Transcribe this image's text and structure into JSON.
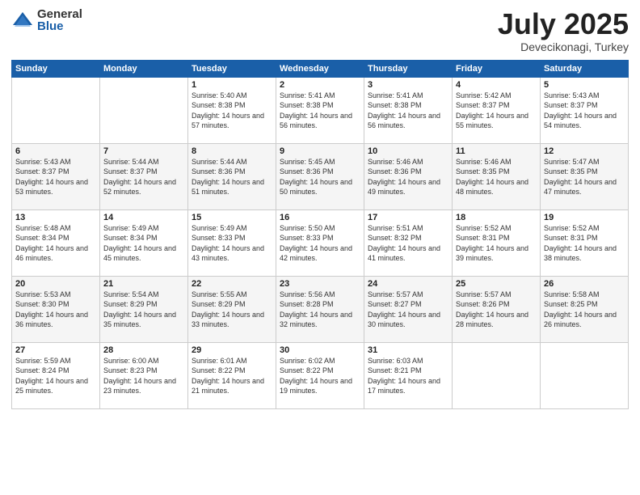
{
  "logo": {
    "general": "General",
    "blue": "Blue"
  },
  "header": {
    "month": "July 2025",
    "location": "Devecikonagi, Turkey"
  },
  "weekdays": [
    "Sunday",
    "Monday",
    "Tuesday",
    "Wednesday",
    "Thursday",
    "Friday",
    "Saturday"
  ],
  "weeks": [
    [
      {
        "day": "",
        "sunrise": "",
        "sunset": "",
        "daylight": ""
      },
      {
        "day": "",
        "sunrise": "",
        "sunset": "",
        "daylight": ""
      },
      {
        "day": "1",
        "sunrise": "Sunrise: 5:40 AM",
        "sunset": "Sunset: 8:38 PM",
        "daylight": "Daylight: 14 hours and 57 minutes."
      },
      {
        "day": "2",
        "sunrise": "Sunrise: 5:41 AM",
        "sunset": "Sunset: 8:38 PM",
        "daylight": "Daylight: 14 hours and 56 minutes."
      },
      {
        "day": "3",
        "sunrise": "Sunrise: 5:41 AM",
        "sunset": "Sunset: 8:38 PM",
        "daylight": "Daylight: 14 hours and 56 minutes."
      },
      {
        "day": "4",
        "sunrise": "Sunrise: 5:42 AM",
        "sunset": "Sunset: 8:37 PM",
        "daylight": "Daylight: 14 hours and 55 minutes."
      },
      {
        "day": "5",
        "sunrise": "Sunrise: 5:43 AM",
        "sunset": "Sunset: 8:37 PM",
        "daylight": "Daylight: 14 hours and 54 minutes."
      }
    ],
    [
      {
        "day": "6",
        "sunrise": "Sunrise: 5:43 AM",
        "sunset": "Sunset: 8:37 PM",
        "daylight": "Daylight: 14 hours and 53 minutes."
      },
      {
        "day": "7",
        "sunrise": "Sunrise: 5:44 AM",
        "sunset": "Sunset: 8:37 PM",
        "daylight": "Daylight: 14 hours and 52 minutes."
      },
      {
        "day": "8",
        "sunrise": "Sunrise: 5:44 AM",
        "sunset": "Sunset: 8:36 PM",
        "daylight": "Daylight: 14 hours and 51 minutes."
      },
      {
        "day": "9",
        "sunrise": "Sunrise: 5:45 AM",
        "sunset": "Sunset: 8:36 PM",
        "daylight": "Daylight: 14 hours and 50 minutes."
      },
      {
        "day": "10",
        "sunrise": "Sunrise: 5:46 AM",
        "sunset": "Sunset: 8:36 PM",
        "daylight": "Daylight: 14 hours and 49 minutes."
      },
      {
        "day": "11",
        "sunrise": "Sunrise: 5:46 AM",
        "sunset": "Sunset: 8:35 PM",
        "daylight": "Daylight: 14 hours and 48 minutes."
      },
      {
        "day": "12",
        "sunrise": "Sunrise: 5:47 AM",
        "sunset": "Sunset: 8:35 PM",
        "daylight": "Daylight: 14 hours and 47 minutes."
      }
    ],
    [
      {
        "day": "13",
        "sunrise": "Sunrise: 5:48 AM",
        "sunset": "Sunset: 8:34 PM",
        "daylight": "Daylight: 14 hours and 46 minutes."
      },
      {
        "day": "14",
        "sunrise": "Sunrise: 5:49 AM",
        "sunset": "Sunset: 8:34 PM",
        "daylight": "Daylight: 14 hours and 45 minutes."
      },
      {
        "day": "15",
        "sunrise": "Sunrise: 5:49 AM",
        "sunset": "Sunset: 8:33 PM",
        "daylight": "Daylight: 14 hours and 43 minutes."
      },
      {
        "day": "16",
        "sunrise": "Sunrise: 5:50 AM",
        "sunset": "Sunset: 8:33 PM",
        "daylight": "Daylight: 14 hours and 42 minutes."
      },
      {
        "day": "17",
        "sunrise": "Sunrise: 5:51 AM",
        "sunset": "Sunset: 8:32 PM",
        "daylight": "Daylight: 14 hours and 41 minutes."
      },
      {
        "day": "18",
        "sunrise": "Sunrise: 5:52 AM",
        "sunset": "Sunset: 8:31 PM",
        "daylight": "Daylight: 14 hours and 39 minutes."
      },
      {
        "day": "19",
        "sunrise": "Sunrise: 5:52 AM",
        "sunset": "Sunset: 8:31 PM",
        "daylight": "Daylight: 14 hours and 38 minutes."
      }
    ],
    [
      {
        "day": "20",
        "sunrise": "Sunrise: 5:53 AM",
        "sunset": "Sunset: 8:30 PM",
        "daylight": "Daylight: 14 hours and 36 minutes."
      },
      {
        "day": "21",
        "sunrise": "Sunrise: 5:54 AM",
        "sunset": "Sunset: 8:29 PM",
        "daylight": "Daylight: 14 hours and 35 minutes."
      },
      {
        "day": "22",
        "sunrise": "Sunrise: 5:55 AM",
        "sunset": "Sunset: 8:29 PM",
        "daylight": "Daylight: 14 hours and 33 minutes."
      },
      {
        "day": "23",
        "sunrise": "Sunrise: 5:56 AM",
        "sunset": "Sunset: 8:28 PM",
        "daylight": "Daylight: 14 hours and 32 minutes."
      },
      {
        "day": "24",
        "sunrise": "Sunrise: 5:57 AM",
        "sunset": "Sunset: 8:27 PM",
        "daylight": "Daylight: 14 hours and 30 minutes."
      },
      {
        "day": "25",
        "sunrise": "Sunrise: 5:57 AM",
        "sunset": "Sunset: 8:26 PM",
        "daylight": "Daylight: 14 hours and 28 minutes."
      },
      {
        "day": "26",
        "sunrise": "Sunrise: 5:58 AM",
        "sunset": "Sunset: 8:25 PM",
        "daylight": "Daylight: 14 hours and 26 minutes."
      }
    ],
    [
      {
        "day": "27",
        "sunrise": "Sunrise: 5:59 AM",
        "sunset": "Sunset: 8:24 PM",
        "daylight": "Daylight: 14 hours and 25 minutes."
      },
      {
        "day": "28",
        "sunrise": "Sunrise: 6:00 AM",
        "sunset": "Sunset: 8:23 PM",
        "daylight": "Daylight: 14 hours and 23 minutes."
      },
      {
        "day": "29",
        "sunrise": "Sunrise: 6:01 AM",
        "sunset": "Sunset: 8:22 PM",
        "daylight": "Daylight: 14 hours and 21 minutes."
      },
      {
        "day": "30",
        "sunrise": "Sunrise: 6:02 AM",
        "sunset": "Sunset: 8:22 PM",
        "daylight": "Daylight: 14 hours and 19 minutes."
      },
      {
        "day": "31",
        "sunrise": "Sunrise: 6:03 AM",
        "sunset": "Sunset: 8:21 PM",
        "daylight": "Daylight: 14 hours and 17 minutes."
      },
      {
        "day": "",
        "sunrise": "",
        "sunset": "",
        "daylight": ""
      },
      {
        "day": "",
        "sunrise": "",
        "sunset": "",
        "daylight": ""
      }
    ]
  ]
}
